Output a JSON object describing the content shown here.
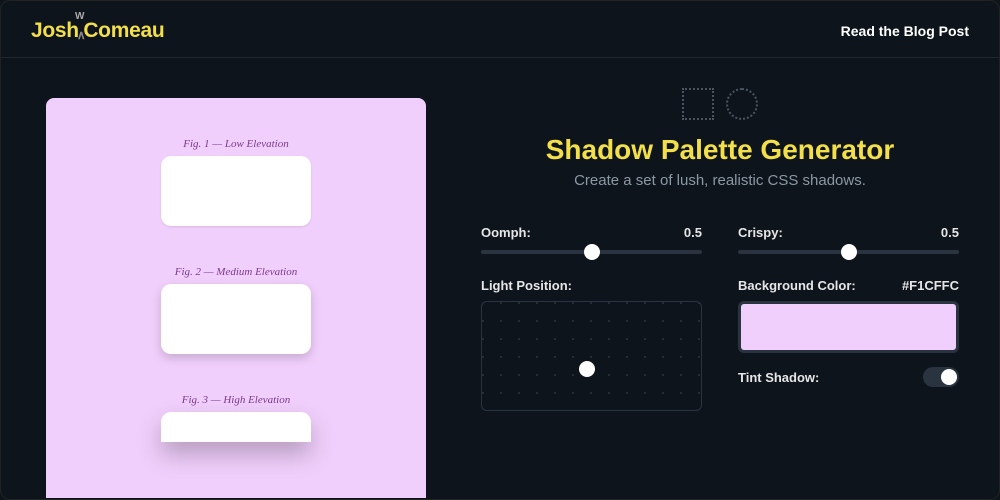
{
  "header": {
    "logo_josh": "Josh",
    "logo_comeau": "Comeau",
    "logo_w": "W",
    "blog_link": "Read the Blog Post"
  },
  "preview": {
    "fig1": "Fig. 1 — Low Elevation",
    "fig2": "Fig. 2 — Medium Elevation",
    "fig3": "Fig. 3 — High Elevation",
    "canvas_bg": "#f1cffc"
  },
  "title": "Shadow Palette Generator",
  "subtitle": "Create a set of lush, realistic CSS shadows.",
  "controls": {
    "oomph": {
      "label": "Oomph:",
      "value": "0.5",
      "pos": 50
    },
    "crispy": {
      "label": "Crispy:",
      "value": "0.5",
      "pos": 50
    },
    "light_label": "Light Position:",
    "bg_label": "Background Color:",
    "bg_value": "#F1CFFC",
    "tint_label": "Tint Shadow:"
  },
  "colors": {
    "accent": "#f3df49",
    "bg": "#0e141b"
  }
}
